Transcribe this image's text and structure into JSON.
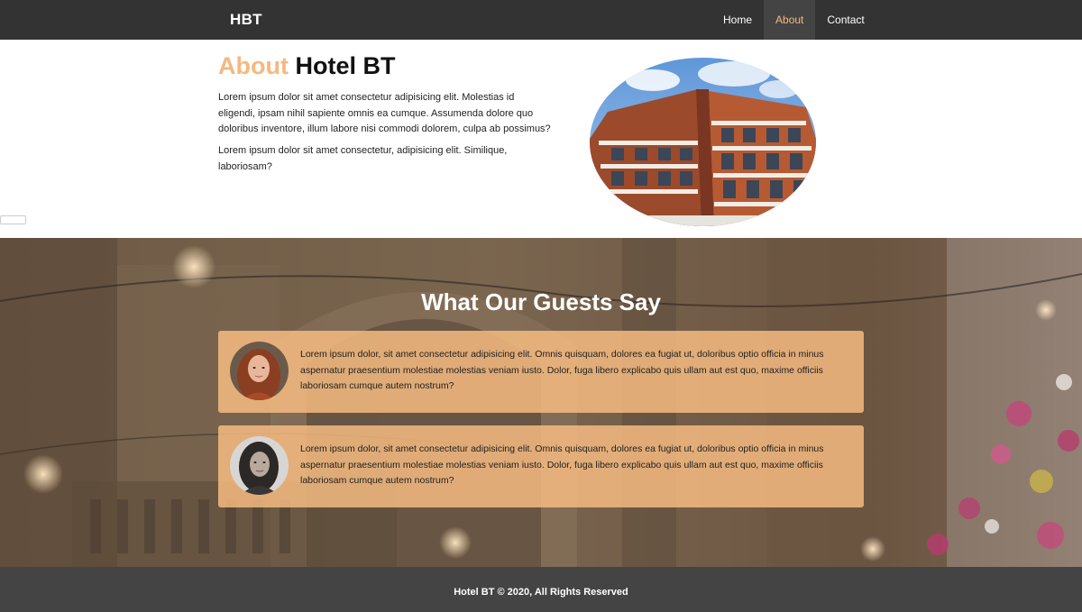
{
  "nav": {
    "brand": "HBT",
    "items": [
      {
        "label": "Home",
        "active": false
      },
      {
        "label": "About",
        "active": true
      },
      {
        "label": "Contact",
        "active": false
      }
    ]
  },
  "about": {
    "title_accent": "About",
    "title_rest": "Hotel BT",
    "paragraph1": "Lorem ipsum dolor sit amet consectetur adipisicing elit. Molestias id eligendi, ipsam nihil sapiente omnis ea cumque. Assumenda dolore quo doloribus inventore, illum labore nisi commodi dolorem, culpa ab possimus?",
    "paragraph2": "Lorem ipsum dolor sit amet consectetur, adipisicing elit. Similique, laboriosam?"
  },
  "testimonials": {
    "title": "What Our Guests Say",
    "items": [
      {
        "text": "Lorem ipsum dolor, sit amet consectetur adipisicing elit. Omnis quisquam, dolores ea fugiat ut, doloribus optio officia in minus aspernatur praesentium molestiae molestias veniam iusto. Dolor, fuga libero explicabo quis ullam aut est quo, maxime officiis laboriosam cumque autem nostrum?"
      },
      {
        "text": "Lorem ipsum dolor, sit amet consectetur adipisicing elit. Omnis quisquam, dolores ea fugiat ut, doloribus optio officia in minus aspernatur praesentium molestiae molestias veniam iusto. Dolor, fuga libero explicabo quis ullam aut est quo, maxime officiis laboriosam cumque autem nostrum?"
      }
    ]
  },
  "footer": {
    "text": "Hotel BT © 2020, All Rights Reserved"
  },
  "colors": {
    "accent": "#f5b880",
    "navbar": "#333333",
    "footer": "#444444",
    "card": "#fabe82"
  }
}
